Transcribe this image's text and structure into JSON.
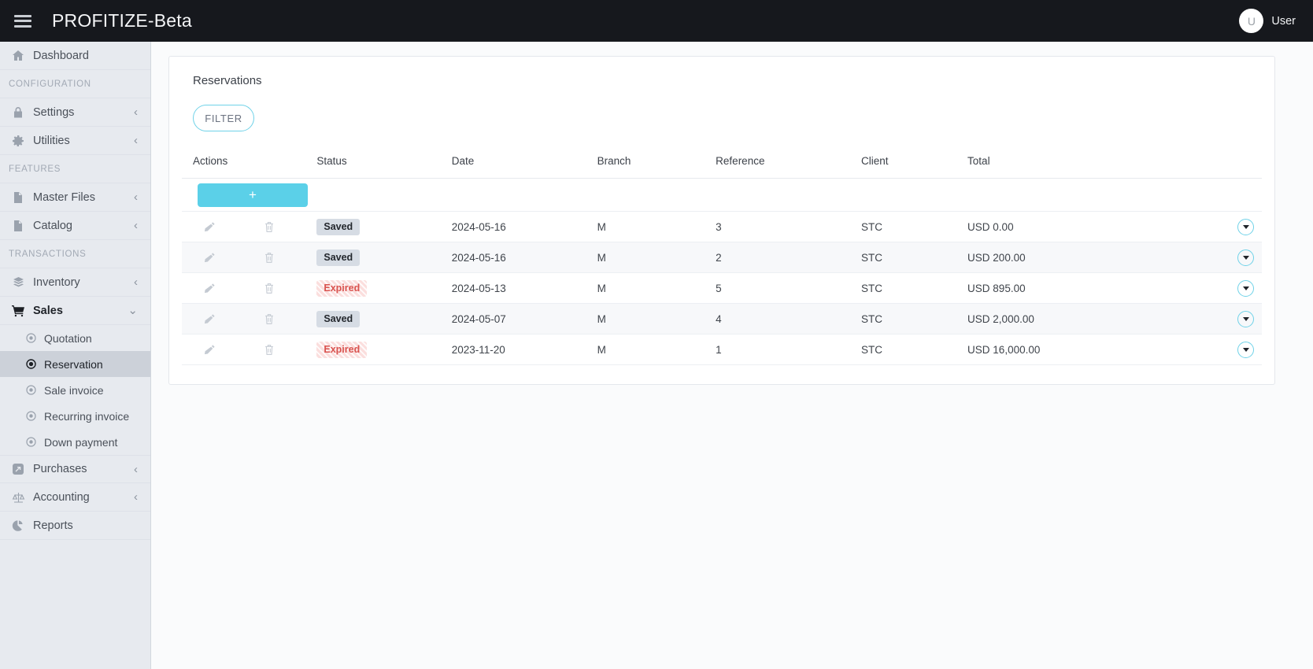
{
  "topbar": {
    "menu_icon": "hamburger-icon",
    "brand": "PROFITIZE-Beta",
    "avatar_initial": "U",
    "username": "User"
  },
  "sidebar": {
    "items": [
      {
        "label": "Dashboard",
        "icon": "home-icon",
        "type": "item",
        "expandable": false
      },
      {
        "label": "CONFIGURATION",
        "type": "section"
      },
      {
        "label": "Settings",
        "icon": "lock-icon",
        "type": "item",
        "expandable": true,
        "chevron": "‹"
      },
      {
        "label": "Utilities",
        "icon": "gear-icon",
        "type": "item",
        "expandable": true,
        "chevron": "‹"
      },
      {
        "label": "FEATURES",
        "type": "section"
      },
      {
        "label": "Master Files",
        "icon": "file-icon",
        "type": "item",
        "expandable": true,
        "chevron": "‹"
      },
      {
        "label": "Catalog",
        "icon": "file-lines-icon",
        "type": "item",
        "expandable": true,
        "chevron": "‹"
      },
      {
        "label": "TRANSACTIONS",
        "type": "section"
      },
      {
        "label": "Inventory",
        "icon": "boxes-icon",
        "type": "item",
        "expandable": true,
        "chevron": "‹"
      },
      {
        "label": "Sales",
        "icon": "cart-icon",
        "type": "item",
        "expandable": true,
        "expanded": true,
        "chevron": "⌄"
      }
    ],
    "sales_submenu": [
      {
        "label": "Quotation",
        "icon": "circle-dot-icon",
        "active": false
      },
      {
        "label": "Reservation",
        "icon": "circle-dot-icon",
        "active": true
      },
      {
        "label": "Sale invoice",
        "icon": "circle-dot-icon",
        "active": false
      },
      {
        "label": "Recurring invoice",
        "icon": "circle-dot-icon",
        "active": false
      },
      {
        "label": "Down payment",
        "icon": "circle-dot-icon",
        "active": false
      }
    ],
    "items_bottom": [
      {
        "label": "Purchases",
        "icon": "purchase-arrow-icon",
        "type": "item",
        "expandable": true,
        "chevron": "‹"
      },
      {
        "label": "Accounting",
        "icon": "scales-icon",
        "type": "item",
        "expandable": true,
        "chevron": "‹"
      },
      {
        "label": "Reports",
        "icon": "pie-chart-icon",
        "type": "item",
        "expandable": false
      }
    ]
  },
  "page": {
    "title": "Reservations",
    "filter_label": "FILTER",
    "add_label": "+",
    "columns": [
      "Actions",
      "Status",
      "Date",
      "Branch",
      "Reference",
      "Client",
      "Total"
    ],
    "rows": [
      {
        "status": "Saved",
        "status_kind": "saved",
        "date": "2024-05-16",
        "branch": "M",
        "reference": "3",
        "client": "STC",
        "total": "USD 0.00"
      },
      {
        "status": "Saved",
        "status_kind": "saved",
        "date": "2024-05-16",
        "branch": "M",
        "reference": "2",
        "client": "STC",
        "total": "USD 200.00"
      },
      {
        "status": "Expired",
        "status_kind": "expired",
        "date": "2024-05-13",
        "branch": "M",
        "reference": "5",
        "client": "STC",
        "total": "USD 895.00"
      },
      {
        "status": "Saved",
        "status_kind": "saved",
        "date": "2024-05-07",
        "branch": "M",
        "reference": "4",
        "client": "STC",
        "total": "USD 2,000.00"
      },
      {
        "status": "Expired",
        "status_kind": "expired",
        "date": "2023-11-20",
        "branch": "M",
        "reference": "1",
        "client": "STC",
        "total": "USD 16,000.00"
      }
    ]
  },
  "colors": {
    "topbar_bg": "#16181d",
    "sidebar_bg": "#e7eaef",
    "accent": "#5bd0e8",
    "saved_badge_bg": "#d6dce4",
    "expired_badge_bg": "#fbdedd",
    "expired_badge_text": "#d9534f"
  }
}
